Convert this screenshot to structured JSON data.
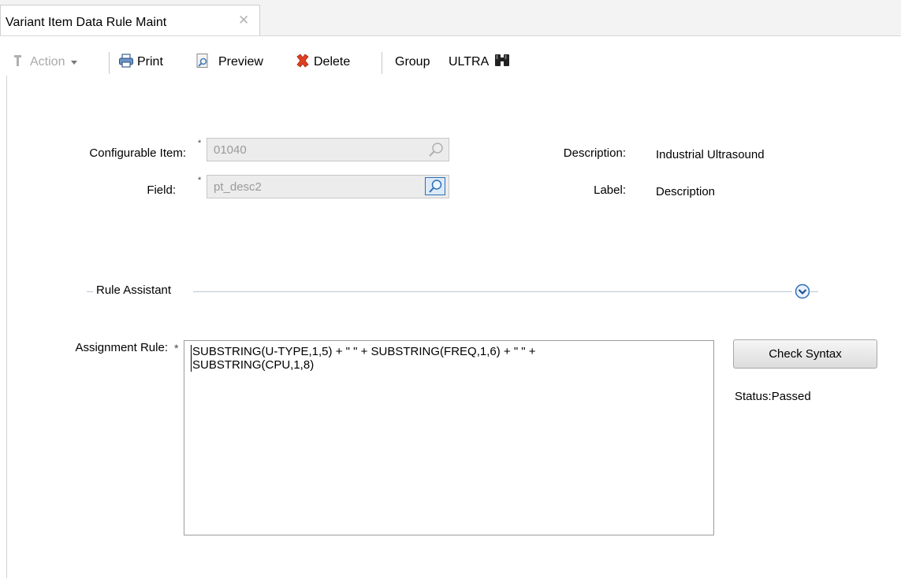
{
  "tab": {
    "title": "Variant Item Data Rule Maint",
    "close_glyph": "✕"
  },
  "toolbar": {
    "action_label": "Action",
    "print_label": "Print",
    "preview_label": "Preview",
    "delete_label": "Delete",
    "group_label": "Group",
    "ultra_label": "ULTRA"
  },
  "form": {
    "configurable_item": {
      "label": "Configurable Item:",
      "required_mark": "*",
      "value": "01040"
    },
    "field": {
      "label": "Field:",
      "required_mark": "*",
      "value": "pt_desc2"
    },
    "description": {
      "label": "Description:",
      "value": "Industrial Ultrasound"
    },
    "label_field": {
      "label": "Label:",
      "value": "Description"
    }
  },
  "rule_assistant": {
    "title": "Rule Assistant"
  },
  "assignment": {
    "label": "Assignment Rule:",
    "required_mark": "*",
    "rule_text": "SUBSTRING(U-TYPE,1,5) + \" \" + SUBSTRING(FREQ,1,6) + \" \" +\nSUBSTRING(CPU,1,8)",
    "check_button_label": "Check Syntax",
    "status_text": "Status:Passed"
  },
  "colors": {
    "accent": "#2f6fb5",
    "delete_red": "#d9341c"
  }
}
